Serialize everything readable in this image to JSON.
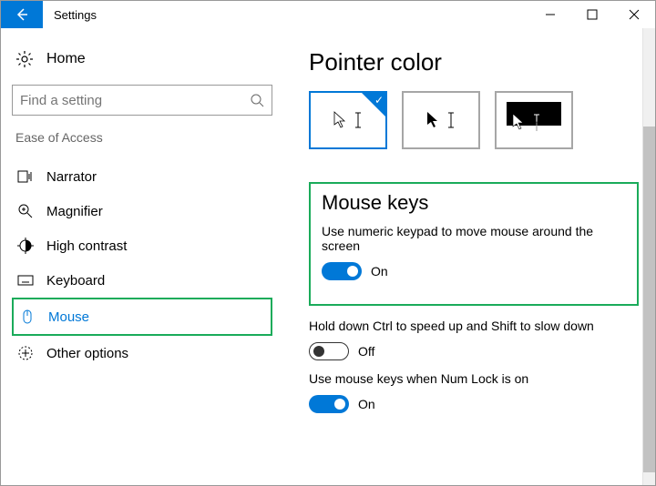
{
  "window": {
    "title": "Settings"
  },
  "sidebar": {
    "home_label": "Home",
    "search_placeholder": "Find a setting",
    "section_label": "Ease of Access",
    "items": [
      {
        "icon": "narrator",
        "label": "Narrator"
      },
      {
        "icon": "magnifier",
        "label": "Magnifier"
      },
      {
        "icon": "contrast",
        "label": "High contrast"
      },
      {
        "icon": "keyboard",
        "label": "Keyboard"
      },
      {
        "icon": "mouse",
        "label": "Mouse"
      },
      {
        "icon": "options",
        "label": "Other options"
      }
    ]
  },
  "content": {
    "pointer_color_heading": "Pointer color",
    "mouse_keys_heading": "Mouse keys",
    "mouse_keys_desc": "Use numeric keypad to move mouse around the screen",
    "mouse_keys_toggle": "On",
    "ctrl_shift_desc": "Hold down Ctrl to speed up and Shift to slow down",
    "ctrl_shift_toggle": "Off",
    "numlock_desc": "Use mouse keys when Num Lock is on",
    "numlock_toggle": "On"
  }
}
